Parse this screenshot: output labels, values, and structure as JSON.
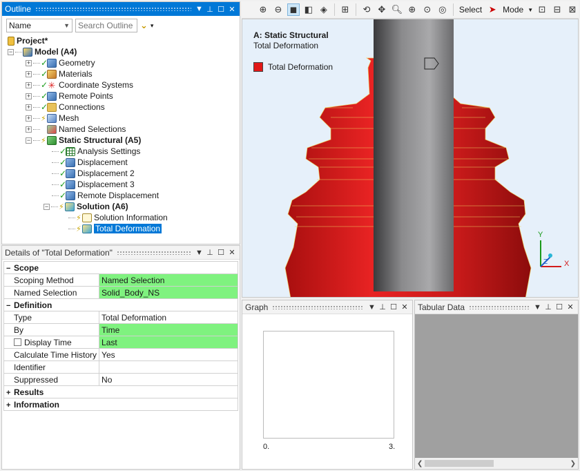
{
  "outline": {
    "title": "Outline",
    "filter_value": "Name",
    "search_placeholder": "Search Outline",
    "tree": {
      "project": "Project*",
      "model": "Model (A4)",
      "geometry": "Geometry",
      "materials": "Materials",
      "coordinate_systems": "Coordinate Systems",
      "remote_points": "Remote Points",
      "connections": "Connections",
      "mesh": "Mesh",
      "named_selections": "Named Selections",
      "static_structural": "Static Structural (A5)",
      "analysis_settings": "Analysis Settings",
      "displacement": "Displacement",
      "displacement2": "Displacement 2",
      "displacement3": "Displacement 3",
      "remote_displacement": "Remote Displacement",
      "solution": "Solution (A6)",
      "solution_information": "Solution Information",
      "total_deformation": "Total Deformation"
    }
  },
  "details": {
    "title": "Details of \"Total Deformation\"",
    "scope": {
      "label": "Scope",
      "scoping_method": {
        "key": "Scoping Method",
        "value": "Named Selection"
      },
      "named_selection": {
        "key": "Named Selection",
        "value": "Solid_Body_NS"
      }
    },
    "definition": {
      "label": "Definition",
      "type": {
        "key": "Type",
        "value": "Total Deformation"
      },
      "by": {
        "key": "By",
        "value": "Time"
      },
      "display_time": {
        "key": "Display Time",
        "value": "Last"
      },
      "calc_time_history": {
        "key": "Calculate Time History",
        "value": "Yes"
      },
      "identifier": {
        "key": "Identifier",
        "value": ""
      },
      "suppressed": {
        "key": "Suppressed",
        "value": "No"
      }
    },
    "results": "Results",
    "information": "Information"
  },
  "toolbar": {
    "select_label": "Select",
    "mode_label": "Mode"
  },
  "viewport": {
    "analysis_title": "A: Static Structural",
    "result_name": "Total Deformation",
    "legend_label": "Total Deformation",
    "axes": {
      "x": "X",
      "y": "Y",
      "z": "Z"
    },
    "colors": {
      "body": "#d91c1c",
      "shaft": "#6e6e70",
      "background": "#e6f0fa"
    }
  },
  "graph": {
    "title": "Graph",
    "x_min_label": "0.",
    "x_max_label": "3."
  },
  "tabular": {
    "title": "Tabular Data"
  }
}
